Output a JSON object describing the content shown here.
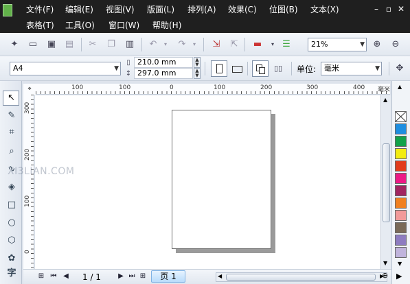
{
  "menu": {
    "row1": [
      "文件(F)",
      "编辑(E)",
      "视图(V)",
      "版面(L)",
      "排列(A)",
      "效果(C)",
      "位图(B)",
      "文本(X)"
    ],
    "row2": [
      "表格(T)",
      "工具(O)",
      "窗口(W)",
      "帮助(H)"
    ],
    "window_controls": {
      "minimize": "–",
      "restore": "▫",
      "close": "✕"
    }
  },
  "toolbar": {
    "zoom_value": "21%"
  },
  "property_bar": {
    "paper_size": "A4",
    "width": "210.0 mm",
    "height": "297.0 mm",
    "units_label": "单位:",
    "units_value": "毫米"
  },
  "ruler": {
    "h_labels": [
      "100",
      "100",
      "0",
      "100",
      "200",
      "300",
      "400"
    ],
    "h_unit": "毫米",
    "v_labels": [
      "300",
      "200",
      "100",
      "0"
    ]
  },
  "watermark": "XI3LIAN.COM",
  "toolbox": {
    "text_tool": "字"
  },
  "palette": {
    "colors": [
      "#ffffff",
      "#1e8ee0",
      "#12a24a",
      "#f2ec12",
      "#e23c1c",
      "#ec1a86",
      "#a12560",
      "#f08020",
      "#f29a9a",
      "#7a6a58",
      "#8d7cc0",
      "#c0b4dc",
      "#7f7fb8"
    ]
  },
  "bottom": {
    "page_counter": "1 / 1",
    "page_tab": "页 1"
  }
}
